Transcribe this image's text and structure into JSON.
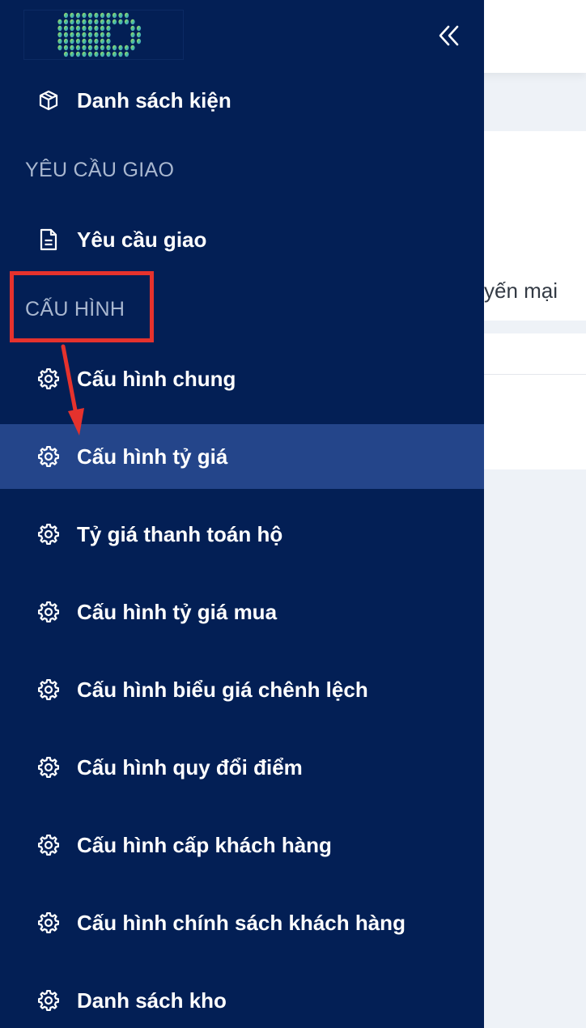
{
  "main": {
    "partial_text": "yến mại"
  },
  "sidebar": {
    "logo_icon": "company-logo",
    "collapse_icon": "double-chevron-left-icon",
    "top_item": {
      "label": "Danh sách kiện",
      "icon": "package-icon"
    },
    "sections": [
      {
        "title": "YÊU CẦU GIAO",
        "items": [
          {
            "label": "Yêu cầu giao",
            "icon": "document-icon"
          }
        ]
      },
      {
        "title": "CẤU HÌNH",
        "items": [
          {
            "label": "Cấu hình chung",
            "icon": "gear-icon"
          },
          {
            "label": "Cấu hình tỷ giá",
            "icon": "gear-icon",
            "active": true
          },
          {
            "label": "Tỷ giá thanh toán hộ",
            "icon": "gear-icon"
          },
          {
            "label": "Cấu hình tỷ giá mua",
            "icon": "gear-icon"
          },
          {
            "label": "Cấu hình biểu giá chênh lệch",
            "icon": "gear-icon"
          },
          {
            "label": "Cấu hình quy đổi điểm",
            "icon": "gear-icon"
          },
          {
            "label": "Cấu hình cấp khách hàng",
            "icon": "gear-icon"
          },
          {
            "label": "Cấu hình chính sách khách hàng",
            "icon": "gear-icon"
          },
          {
            "label": "Danh sách kho",
            "icon": "gear-icon"
          }
        ]
      }
    ]
  },
  "annotation": {
    "color": "#e5322d",
    "highlight_target": "section-title-cau-hinh",
    "arrow_target": "menu-item-cau-hinh-ty-gia"
  },
  "colors": {
    "sidebar_bg": "#031f55",
    "active_bg": "#24458a",
    "section_title": "#a9b7cf"
  }
}
